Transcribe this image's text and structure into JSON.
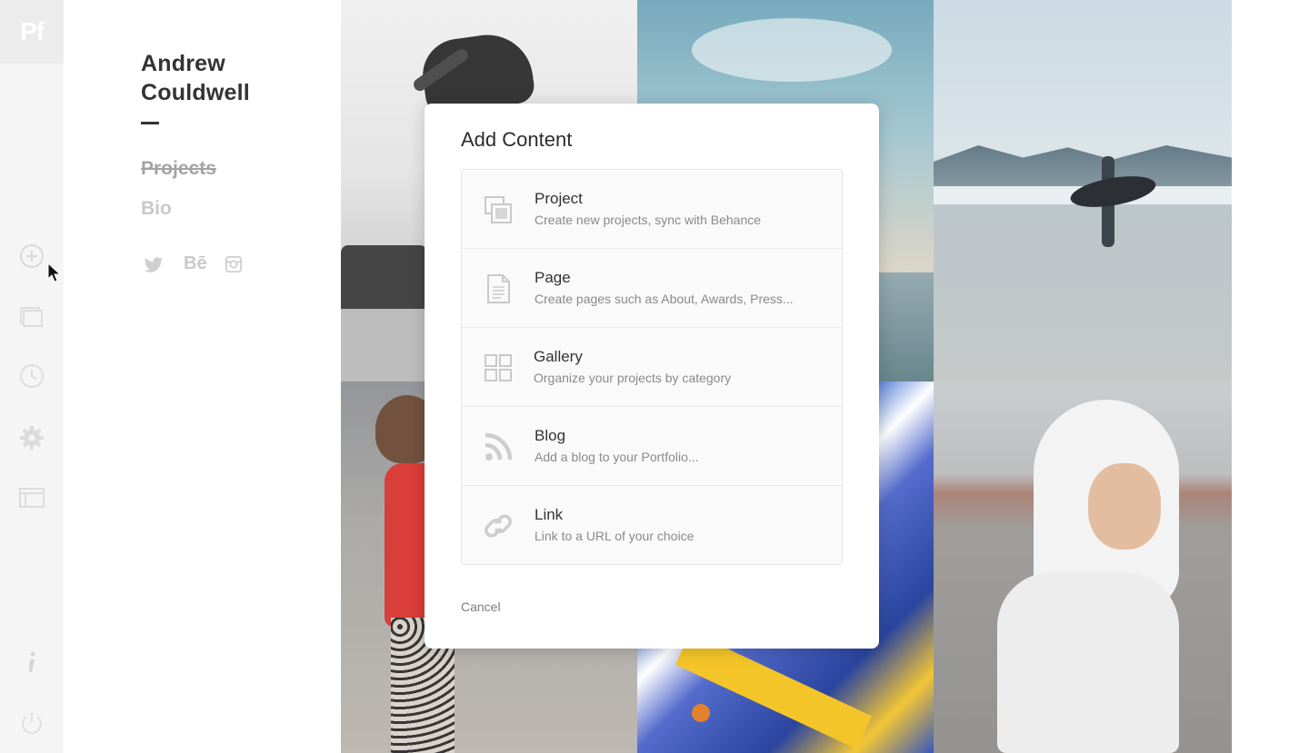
{
  "toolbar": {
    "logo": "Pf",
    "icons": [
      "add-icon",
      "pages-icon",
      "history-icon",
      "settings-icon",
      "layout-icon",
      "info-icon",
      "power-icon"
    ]
  },
  "site": {
    "name_line1": "Andrew",
    "name_line2": "Couldwell",
    "nav": [
      {
        "label": "Projects"
      },
      {
        "label": "Bio"
      }
    ],
    "social": [
      "twitter-icon",
      "behance-icon",
      "instagram-icon"
    ],
    "social_behance_text": "Bē"
  },
  "modal": {
    "title": "Add Content",
    "options": [
      {
        "label": "Project",
        "description": "Create new projects, sync with Behance",
        "icon": "project-icon"
      },
      {
        "label": "Page",
        "description": "Create pages such as About, Awards, Press...",
        "icon": "page-icon"
      },
      {
        "label": "Gallery",
        "description": "Organize your projects by category",
        "icon": "gallery-icon"
      },
      {
        "label": "Blog",
        "description": "Add a blog to your Portfolio...",
        "icon": "rss-icon"
      },
      {
        "label": "Link",
        "description": "Link to a URL of your choice",
        "icon": "link-icon"
      }
    ],
    "cancel_label": "Cancel"
  },
  "colors": {
    "toolbar_bg": "#f5f5f5",
    "muted_text": "#c9c9c9",
    "modal_bg": "#ffffff",
    "option_bg": "#fafafa"
  }
}
